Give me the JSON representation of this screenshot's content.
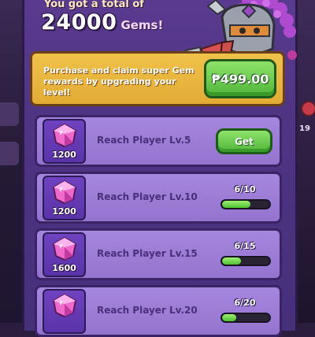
{
  "header": {
    "line1": "You got a total of",
    "amount": "24000",
    "unit": "Gems!"
  },
  "offer": {
    "text": "Purchase and claim super Gem rewards by upgrading your level!",
    "price": "₱499.00"
  },
  "side": {
    "badge_count": "19"
  },
  "rewards": [
    {
      "gems": "1200",
      "label": "Reach Player Lv.5",
      "status": "claimable",
      "button": "Get"
    },
    {
      "gems": "1200",
      "label": "Reach Player Lv.10",
      "status": "progress",
      "progress_text": "6/10",
      "progress": 0.6
    },
    {
      "gems": "1600",
      "label": "Reach Player Lv.15",
      "status": "progress",
      "progress_text": "6/15",
      "progress": 0.4
    },
    {
      "gems": "",
      "label": "Reach Player Lv.20",
      "status": "progress",
      "progress_text": "6/20",
      "progress": 0.3
    }
  ],
  "colors": {
    "panel": "#5b3b91",
    "offer": "#f0c24a",
    "button_green": "#4fb53a",
    "row": "#a586dd",
    "gem": "#f06acb"
  },
  "icons": [
    "gem-icon",
    "knight-mascot"
  ]
}
